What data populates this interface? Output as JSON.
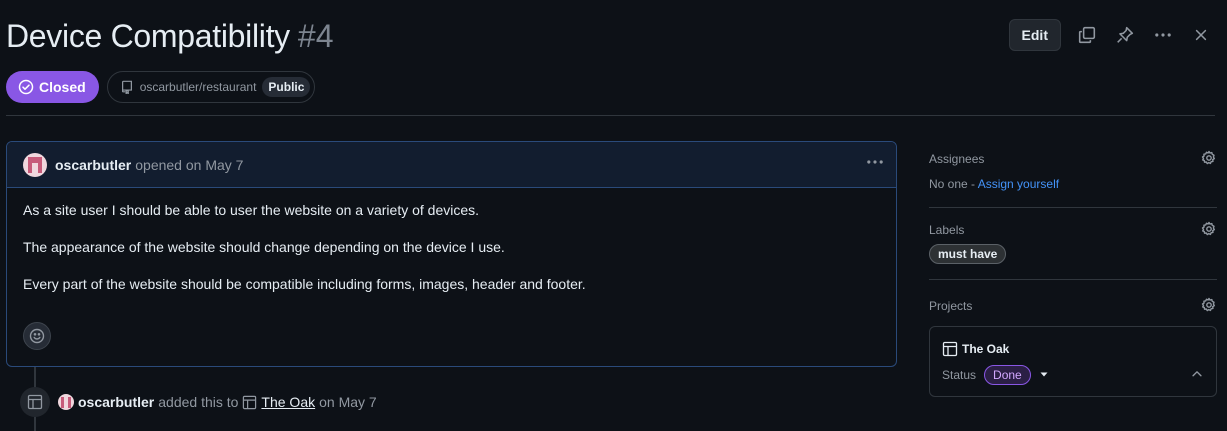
{
  "issue": {
    "title": "Device Compatibility",
    "number": "#4",
    "state": "Closed",
    "repo": "oscarbutler/restaurant",
    "visibility": "Public"
  },
  "toolbar": {
    "edit_label": "Edit"
  },
  "comment": {
    "author": "oscarbutler",
    "opened_text": "opened on May 7",
    "paragraphs": [
      "As a site user I should be able to user the website on a variety of devices.",
      "The appearance of the website should change depending on the device I use.",
      "Every part of the website should be compatible including forms, images, header and footer."
    ]
  },
  "timeline": {
    "author": "oscarbutler",
    "action": "added this to",
    "project": "The Oak",
    "date": "on May 7"
  },
  "sidebar": {
    "assignees": {
      "heading": "Assignees",
      "none_text": "No one -",
      "assign_link": "Assign yourself"
    },
    "labels": {
      "heading": "Labels",
      "items": [
        "must have"
      ]
    },
    "projects": {
      "heading": "Projects",
      "project_name": "The Oak",
      "status_label": "Status",
      "status_value": "Done"
    }
  },
  "colors": {
    "closed_badge": "#8957e5",
    "link": "#4493f8",
    "background": "#0d1117"
  }
}
